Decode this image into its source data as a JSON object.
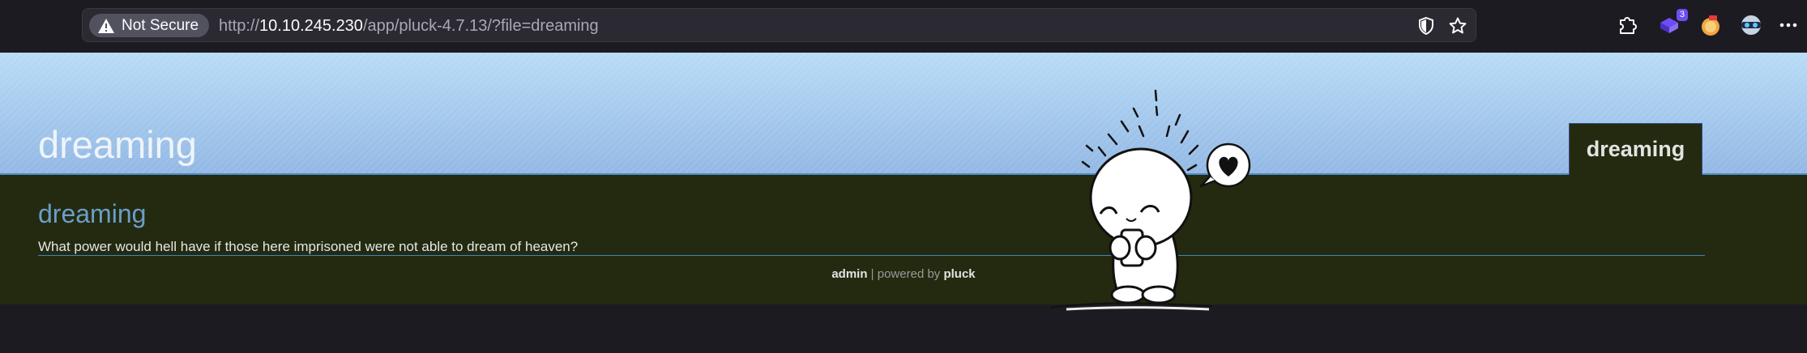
{
  "browser": {
    "security_label": "Not Secure",
    "url": {
      "scheme": "http://",
      "host": "10.10.245.230",
      "path": "/app/pluck-4.7.13/?file=dreaming"
    },
    "extensions_badge": "3",
    "icons": [
      "warning-icon",
      "shield-icon",
      "star-icon",
      "extensions-icon",
      "extension-badge-icon",
      "extension-food-icon",
      "extension-mask-icon",
      "more-icon"
    ]
  },
  "site": {
    "title": "dreaming",
    "nav": [
      {
        "label": "dreaming"
      }
    ]
  },
  "page": {
    "heading": "dreaming",
    "text": "What power would hell have if those here imprisoned were not able to dream of heaven?"
  },
  "footer": {
    "admin": "admin",
    "separator": " | powered by ",
    "brand": "pluck"
  },
  "colors": {
    "header_top": "#b8dcf7",
    "header_bottom": "#93b8e4",
    "content_bg": "#232a0f",
    "heading": "#6b9ec9",
    "rule": "#3f83c2"
  }
}
